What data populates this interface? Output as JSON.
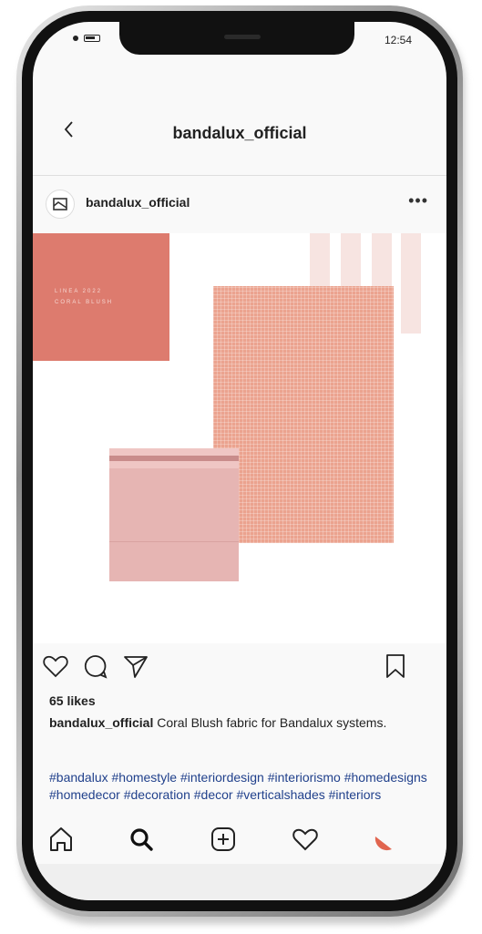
{
  "status": {
    "time": "12:54"
  },
  "header": {
    "title": "bandalux_official"
  },
  "post": {
    "username": "bandalux_official",
    "image_text": {
      "line1": "LINEA 2022",
      "line2": "CORAL BLUSH"
    },
    "likes": "65 likes",
    "caption_user": "bandalux_official",
    "caption_text": " Coral Blush fabric for Bandalux systems.",
    "hashtags": "#bandalux #homestyle #interiordesign #interiorismo #homedesigns #homedecor #decoration #decor #verticalshades #interiors"
  },
  "icons": [
    "back-icon",
    "more-icon",
    "heart-icon",
    "comment-icon",
    "share-icon",
    "bookmark-icon",
    "home-icon",
    "search-icon",
    "add-icon",
    "activity-icon",
    "profile-icon"
  ],
  "colors": {
    "coral": "#dd7b6e",
    "fabric": "#eba38f",
    "hashtag": "#21418c",
    "profile_accent": "#e1654f"
  }
}
